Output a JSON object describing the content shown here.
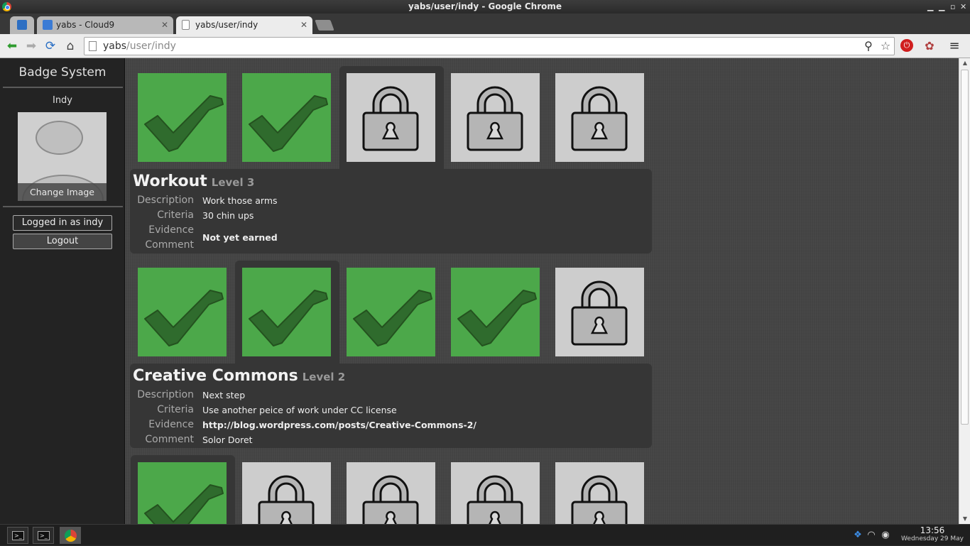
{
  "window": {
    "title": "yabs/user/indy - Google Chrome"
  },
  "tabs": [
    {
      "label": "",
      "icon": "app-icon"
    },
    {
      "label": "yabs - Cloud9",
      "icon": "cloud9-icon"
    },
    {
      "label": "yabs/user/indy",
      "icon": "page-icon",
      "active": true
    }
  ],
  "toolbar": {
    "url_host": "yabs",
    "url_path": "/user/indy"
  },
  "sidebar": {
    "brand": "Badge System",
    "username": "Indy",
    "change_image": "Change Image",
    "logged_in": "Logged in as indy",
    "logout": "Logout"
  },
  "badge_groups": [
    {
      "tiles": [
        "earned",
        "earned",
        "locked",
        "locked",
        "locked"
      ],
      "selected_index": 2,
      "title": "Workout",
      "level": "Level 3",
      "labels": {
        "description": "Description",
        "criteria": "Criteria",
        "evidence": "Evidence",
        "comment": "Comment"
      },
      "description": "Work those arms",
      "criteria": "30 chin ups",
      "evidence_comment_status": "Not yet earned"
    },
    {
      "tiles": [
        "earned",
        "earned",
        "earned",
        "earned",
        "locked"
      ],
      "selected_index": 1,
      "title": "Creative Commons",
      "level": "Level 2",
      "labels": {
        "description": "Description",
        "criteria": "Criteria",
        "evidence": "Evidence",
        "comment": "Comment"
      },
      "description": "Next step",
      "criteria": "Use another peice of work under CC license",
      "evidence": "http://blog.wordpress.com/posts/Creative-Commons-2/",
      "comment": "Solor Doret"
    },
    {
      "tiles": [
        "earned",
        "locked",
        "locked",
        "locked",
        "locked"
      ],
      "selected_index": 0
    }
  ],
  "taskbar": {
    "time": "13:56",
    "date": "Wednesday 29 May"
  },
  "colors": {
    "earned": "#4ca84a",
    "locked": "#cdcdcd",
    "check": "#2f6b2d"
  }
}
